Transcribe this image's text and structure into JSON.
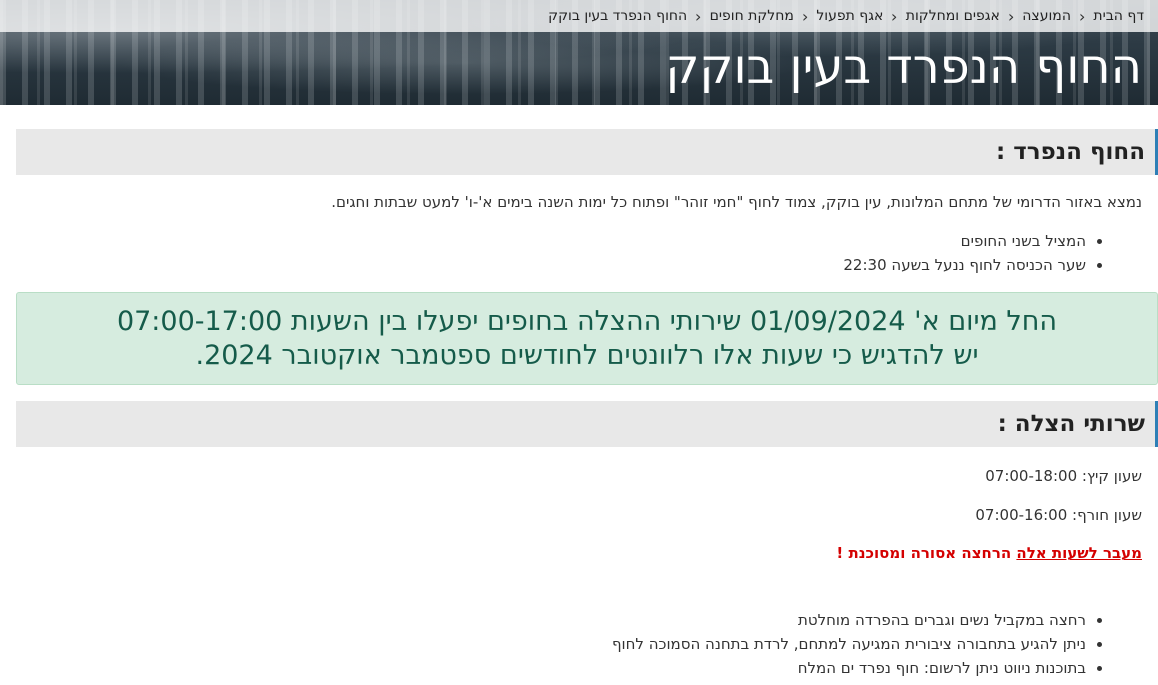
{
  "breadcrumb": {
    "items": [
      "דף הבית",
      "המועצה",
      "אגפים ומחלקות",
      "אגף תפעול",
      "מחלקת חופים",
      "החוף הנפרד בעין בוקק"
    ],
    "separator_icon": "chevron-left-icon"
  },
  "page_title": "החוף הנפרד בעין בוקק",
  "section1": {
    "title": "החוף הנפרד :",
    "description": "נמצא באזור הדרומי של מתחם המלונות, עין בוקק, צמוד לחוף \"חמי זוהר\" ופתוח כל ימות השנה בימים א'-ו' למעט שבתות וחגים.",
    "bullets": [
      "המציל  בשני החופים",
      "שער הכניסה לחוף ננעל בשעה 22:30"
    ]
  },
  "alert": {
    "line1": "החל מיום א' 01/09/2024 שירותי ההצלה בחופים יפעלו בין השעות 07:00-17:00",
    "line2": "יש להדגיש כי שעות אלו רלוונטים לחודשים ספטמבר אוקטובר 2024."
  },
  "section2": {
    "title": "שרותי הצלה :",
    "summer": "שעון קיץ:  07:00-18:00",
    "winter": "שעון חורף: 07:00-16:00",
    "warning_link": "מעבר לשעות אלה",
    "warning_text": " הרחצה אסורה ומסוכנת !",
    "bullets": [
      "רחצה במקביל נשים וגברים בהפרדה מוחלטת",
      "ניתן להגיע בתחבורה ציבורית המגיעה למתחם, לרדת בתחנה הסמוכה לחוף",
      "בתוכנות ניווט ניתן לרשום: חוף נפרד ים המלח"
    ]
  },
  "colors": {
    "accent": "#2e7fb6",
    "alert_bg": "#d6ecdf",
    "alert_text": "#155b4a",
    "warning": "#d40000"
  }
}
